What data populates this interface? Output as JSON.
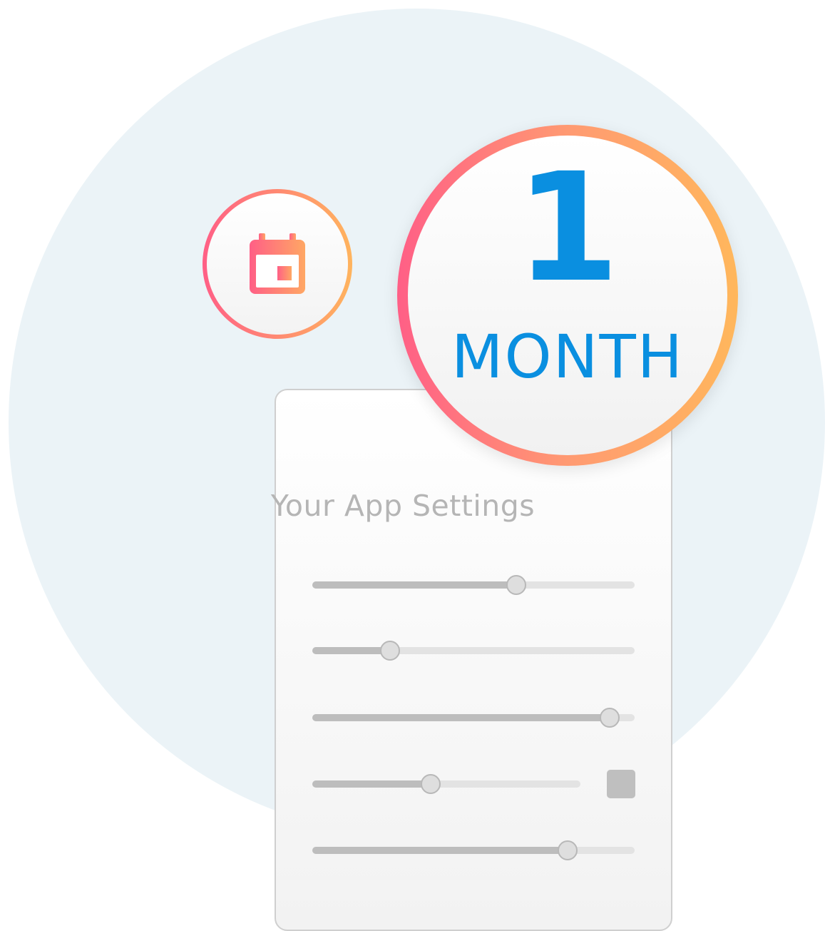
{
  "card": {
    "title": "Your App Settings"
  },
  "sliders": [
    {
      "value": 0.63
    },
    {
      "value": 0.24
    },
    {
      "value": 0.92
    },
    {
      "value": 0.44
    },
    {
      "value": 0.79
    }
  ],
  "badge": {
    "number": "1",
    "unit": "MONTH"
  },
  "icons": {
    "calendar": "calendar-icon"
  },
  "colors": {
    "accent_blue": "#0a8fe0",
    "gradient_start": "#ff5f86",
    "gradient_end": "#ffb45e",
    "background_circle": "#ebf3f7"
  }
}
